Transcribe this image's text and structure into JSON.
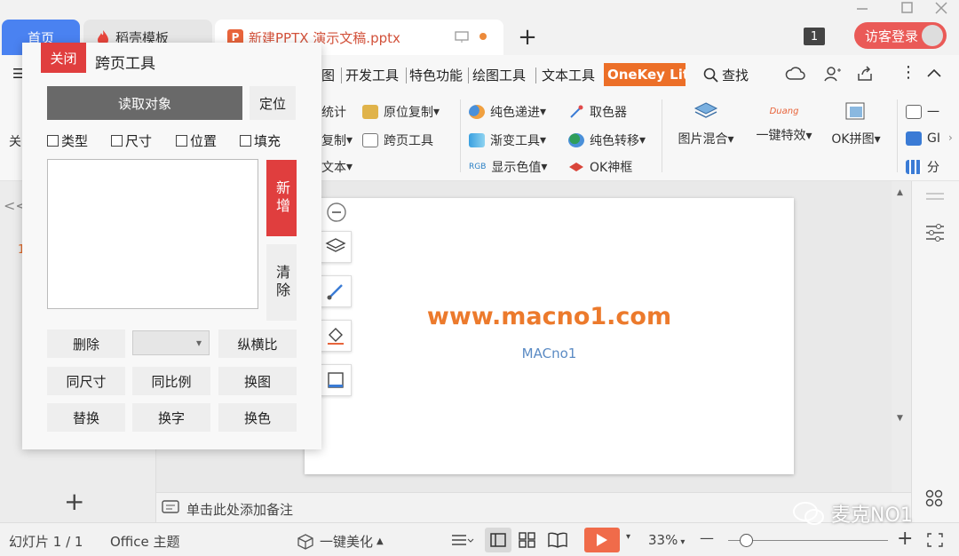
{
  "titlebar": {
    "tabs": [
      {
        "label": "首页"
      },
      {
        "label": "稻壳模板"
      },
      {
        "label": "新建PPTX 演示文稿.pptx"
      }
    ],
    "new_tab": "+",
    "page_count_badge": "1",
    "login_label": "访客登录"
  },
  "menubar": {
    "items": [
      "图",
      "开发工具",
      "特色功能",
      "绘图工具",
      "文本工具"
    ],
    "onekey_label": "OneKey Lite",
    "search_label": "查找"
  },
  "ribbon": {
    "left_fragments": [
      "关",
      "统计",
      "复制",
      "文本"
    ],
    "group1": [
      "原位复制",
      "跨页工具"
    ],
    "group2": [
      "纯色递进",
      "渐变工具",
      "显示色值",
      "RGB"
    ],
    "group3": [
      "取色器",
      "纯色转移",
      "OK神框"
    ],
    "group4": [
      "图片混合",
      "一键特效",
      "OK拼图",
      "Duang"
    ],
    "right_fragments": [
      "一",
      "GI",
      "分"
    ]
  },
  "slide": {
    "title": "www.macno1.com",
    "subtitle": "MACno1"
  },
  "notes_placeholder": "单击此处添加备注",
  "leftpanel": {
    "collapse": "<<",
    "slide_number": "1",
    "add": "+"
  },
  "statusbar": {
    "slide_info": "幻灯片 1 / 1",
    "theme": "Office 主题",
    "beautify": "一键美化",
    "zoom": "33%",
    "minus": "—",
    "plus": "+"
  },
  "dialog": {
    "close": "关闭",
    "title": "跨页工具",
    "read_object": "读取对象",
    "locate": "定位",
    "checkboxes": [
      "类型",
      "尺寸",
      "位置",
      "填充"
    ],
    "new": "新增",
    "clear": "清除",
    "delete": "删除",
    "aspect_ratio": "纵横比",
    "same_size": "同尺寸",
    "same_ratio": "同比例",
    "swap_image": "换图",
    "replace": "替换",
    "swap_text": "换字",
    "swap_color": "换色"
  },
  "watermark": "麦克NO1",
  "colors": {
    "accent_red": "#e03e3e",
    "onekey_orange": "#ec6f28",
    "home_tab_blue": "#4a82f1",
    "slide_title_orange": "#ec7a2c"
  }
}
